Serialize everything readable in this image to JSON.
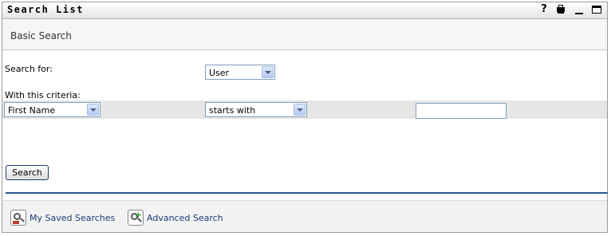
{
  "window": {
    "title": "Search List",
    "help_label": "?"
  },
  "subheader": {
    "label": "Basic Search"
  },
  "form": {
    "search_for_label": "Search for:",
    "search_for_value": "User",
    "criteria_label": "With this criteria:",
    "attribute_value": "First Name",
    "operator_value": "starts with",
    "criteria_input_value": "",
    "search_button_label": "Search"
  },
  "footer": {
    "saved_searches_label": "My Saved Searches",
    "advanced_search_label": "Advanced Search"
  },
  "icons": {
    "help": "help-icon",
    "print": "print-icon",
    "minimize": "minimize-icon",
    "maximize": "maximize-icon",
    "saved_searches": "saved-searches-icon",
    "advanced_search": "advanced-search-icon"
  },
  "colors": {
    "divider": "#2a5a8c",
    "link": "#1a3d7a",
    "input_border": "#7f9db9"
  }
}
